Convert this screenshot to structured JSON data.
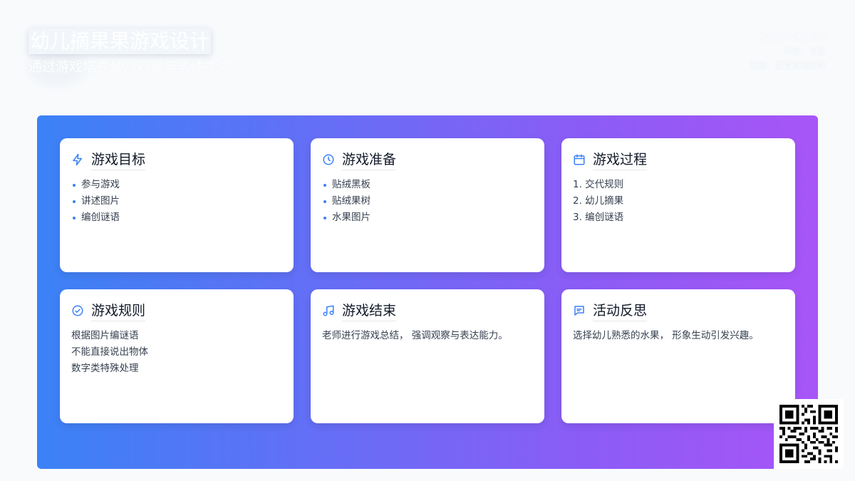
{
  "header": {
    "title": "幼儿摘果果游戏设计",
    "subtitle": "通过游戏培养幼儿观察与表达能力",
    "date": "2025-05-27",
    "author_line": "作者：张静",
    "source_line": "来源：教育资源网站"
  },
  "theme": {
    "panel_gradient_start": "#3b82f6",
    "panel_gradient_end": "#a855f7",
    "accent": "#3b82f6"
  },
  "cards": [
    {
      "title": "游戏目标",
      "icon": "lightning-icon",
      "style": "bullets",
      "items": [
        "参与游戏",
        "讲述图片",
        "编创谜语"
      ]
    },
    {
      "title": "游戏准备",
      "icon": "clock-icon",
      "style": "bullets",
      "items": [
        "贴绒黑板",
        "贴绒果树",
        "水果图片"
      ]
    },
    {
      "title": "游戏过程",
      "icon": "calendar-icon",
      "style": "plain",
      "items": [
        "1. 交代规则",
        "2. 幼儿摘果",
        "3. 编创谜语"
      ]
    },
    {
      "title": "游戏规则",
      "icon": "check-circle-icon",
      "style": "plain",
      "items": [
        "根据图片编谜语",
        "不能直接说出物体",
        "数字类特殊处理"
      ]
    },
    {
      "title": "游戏结束",
      "icon": "music-note-icon",
      "style": "plain",
      "items": [
        "老师进行游戏总结， 强调观察与表达能力。"
      ]
    },
    {
      "title": "活动反思",
      "icon": "message-icon",
      "style": "plain",
      "items": [
        "选择幼儿熟悉的水果， 形象生动引发兴趣。"
      ]
    }
  ]
}
